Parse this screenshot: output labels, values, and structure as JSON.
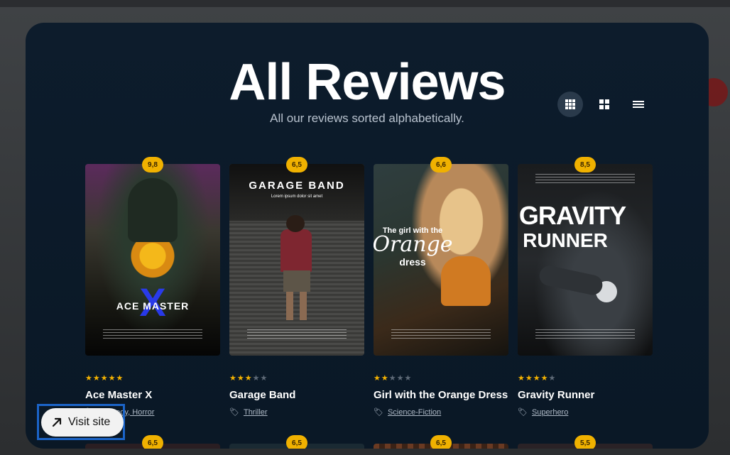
{
  "page": {
    "title": "All Reviews",
    "subtitle": "All our reviews sorted alphabetically."
  },
  "view_options": [
    {
      "name": "grid-small",
      "active": true
    },
    {
      "name": "grid-large",
      "active": false
    },
    {
      "name": "list",
      "active": false
    }
  ],
  "cards": [
    {
      "score": "9,8",
      "stars": 5,
      "title": "Ace Master X",
      "genre": "Comedy, Horror",
      "poster_title": "ACE MASTER",
      "poster_mark": "X"
    },
    {
      "score": "6,5",
      "stars": 3,
      "title": "Garage Band",
      "genre": "Thriller",
      "poster_title": "GARAGE BAND",
      "poster_subtitle": "Lorem ipsum dolor sit amet"
    },
    {
      "score": "6,6",
      "stars": 2,
      "title": "Girl with the Orange Dress",
      "genre": "Science-Fiction",
      "poster_line1": "The girl with the",
      "poster_line2": "Orange",
      "poster_line3": "dress"
    },
    {
      "score": "8,5",
      "stars": 4,
      "title": "Gravity Runner",
      "genre": "Superhero",
      "poster_line1": "GRAVITY",
      "poster_line2": "RUNNER"
    }
  ],
  "next_row_scores": [
    "6,5",
    "6,5",
    "6,5",
    "5,5"
  ],
  "visit_button": {
    "label": "Visit site"
  }
}
